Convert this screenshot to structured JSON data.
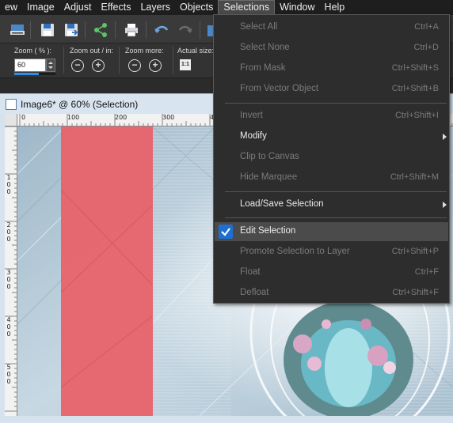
{
  "menubar": {
    "items": [
      {
        "label": "ew",
        "active": false
      },
      {
        "label": "Image",
        "active": false
      },
      {
        "label": "Adjust",
        "active": false
      },
      {
        "label": "Effects",
        "active": false
      },
      {
        "label": "Layers",
        "active": false
      },
      {
        "label": "Objects",
        "active": false
      },
      {
        "label": "Selections",
        "active": true
      },
      {
        "label": "Window",
        "active": false
      },
      {
        "label": "Help",
        "active": false
      }
    ]
  },
  "toolbar": {
    "icons": [
      "scanner-icon",
      "save-icon",
      "save-as-icon",
      "share-icon",
      "print-icon",
      "undo-icon",
      "redo-icon"
    ]
  },
  "optionbar": {
    "zoom_label": "Zoom ( % ):",
    "zoom_value": "60",
    "zoom_progress": 0.6,
    "zoom_out_in_label": "Zoom out / in:",
    "zoom_more_label": "Zoom more:",
    "actual_size_label": "Actual size:",
    "actual_size_button": "1:1"
  },
  "document": {
    "title": "Image6* @  60% (Selection)",
    "ruler_top_labels": [
      "0",
      "100",
      "200",
      "300",
      "4"
    ],
    "ruler_left_labels": [
      "1\n0\n0",
      "2\n0\n0",
      "3\n0\n0",
      "4\n0\n0",
      "5\n0\n0"
    ],
    "selection_color": "#e8626a"
  },
  "selections_menu": {
    "items": [
      {
        "label": "Select All",
        "shortcut": "Ctrl+A",
        "enabled": false
      },
      {
        "label": "Select None",
        "shortcut": "Ctrl+D",
        "enabled": false
      },
      {
        "label": "From Mask",
        "shortcut": "Ctrl+Shift+S",
        "enabled": false
      },
      {
        "label": "From Vector Object",
        "shortcut": "Ctrl+Shift+B",
        "enabled": false
      },
      {
        "label": "Invert",
        "shortcut": "Ctrl+Shift+I",
        "enabled": false
      },
      {
        "label": "Modify",
        "shortcut": "",
        "enabled": true,
        "submenu": true
      },
      {
        "label": "Clip to Canvas",
        "shortcut": "",
        "enabled": false
      },
      {
        "label": "Hide Marquee",
        "shortcut": "Ctrl+Shift+M",
        "enabled": false
      },
      {
        "label": "Load/Save Selection",
        "shortcut": "",
        "enabled": true,
        "submenu": true
      },
      {
        "label": "Edit Selection",
        "shortcut": "",
        "enabled": true,
        "checked": true,
        "highlighted": true
      },
      {
        "label": "Promote Selection to Layer",
        "shortcut": "Ctrl+Shift+P",
        "enabled": false
      },
      {
        "label": "Float",
        "shortcut": "Ctrl+F",
        "enabled": false
      },
      {
        "label": "Defloat",
        "shortcut": "Ctrl+Shift+F",
        "enabled": false
      }
    ]
  }
}
